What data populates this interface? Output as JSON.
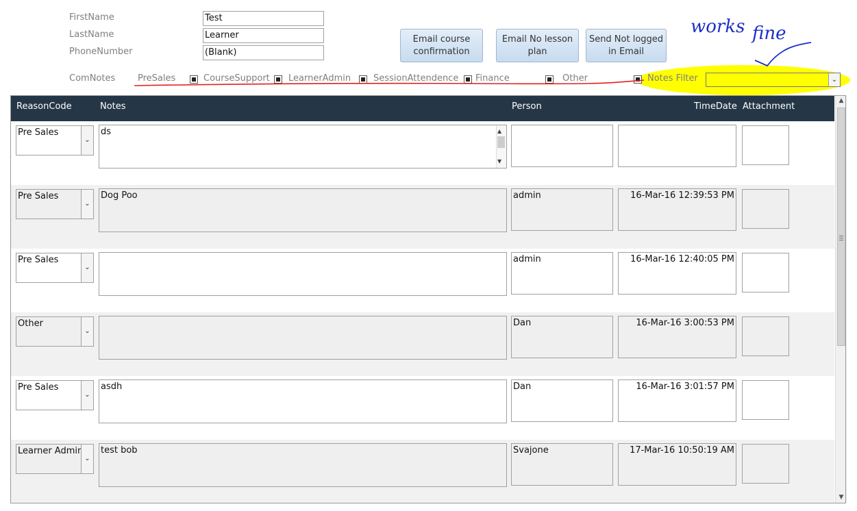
{
  "form": {
    "firstname_label": "FirstName",
    "lastname_label": "LastName",
    "phone_label": "PhoneNumber",
    "firstname_value": "Test",
    "lastname_value": "Learner",
    "phone_value": "(Blank)"
  },
  "buttons": {
    "email_course_confirmation": "Email course confirmation",
    "email_no_lesson_plan": "Email No lesson plan",
    "send_not_logged": "Send Not logged in Email"
  },
  "filters": {
    "comnotes_label": "ComNotes",
    "presales": "PreSales",
    "coursesupport": "CourseSupport",
    "learneradmin": "LearnerAdmin",
    "sessionattendence": "SessionAttendence",
    "finance": "Finance",
    "other": "Other",
    "notes_filter_label": "Notes Filter",
    "notes_filter_value": ""
  },
  "annotation": {
    "text_works": "works",
    "text_fine": "fine"
  },
  "colors": {
    "header_bg": "#253746",
    "highlight": "#ffff00",
    "annotation_blue": "#1a2ec8",
    "underline_red": "#e02020"
  },
  "table": {
    "headers": {
      "reason_code": "ReasonCode",
      "notes": "Notes",
      "person": "Person",
      "timedate": "TimeDate",
      "attachment": "Attachment"
    },
    "rows": [
      {
        "reason": "Pre Sales",
        "notes": "ds",
        "person": "",
        "timedate": ""
      },
      {
        "reason": "Pre Sales",
        "notes": "Dog Poo",
        "person": "admin",
        "timedate": "16-Mar-16 12:39:53 PM"
      },
      {
        "reason": "Pre Sales",
        "notes": "",
        "person": "admin",
        "timedate": "16-Mar-16 12:40:05 PM"
      },
      {
        "reason": "Other",
        "notes": "",
        "person": "Dan",
        "timedate": "16-Mar-16 3:00:53 PM"
      },
      {
        "reason": "Pre Sales",
        "notes": "asdh",
        "person": "Dan",
        "timedate": "16-Mar-16 3:01:57 PM"
      },
      {
        "reason": "Learner Admin",
        "notes": "test bob",
        "person": "Svajone",
        "timedate": "17-Mar-16 10:50:19 AM"
      }
    ]
  }
}
